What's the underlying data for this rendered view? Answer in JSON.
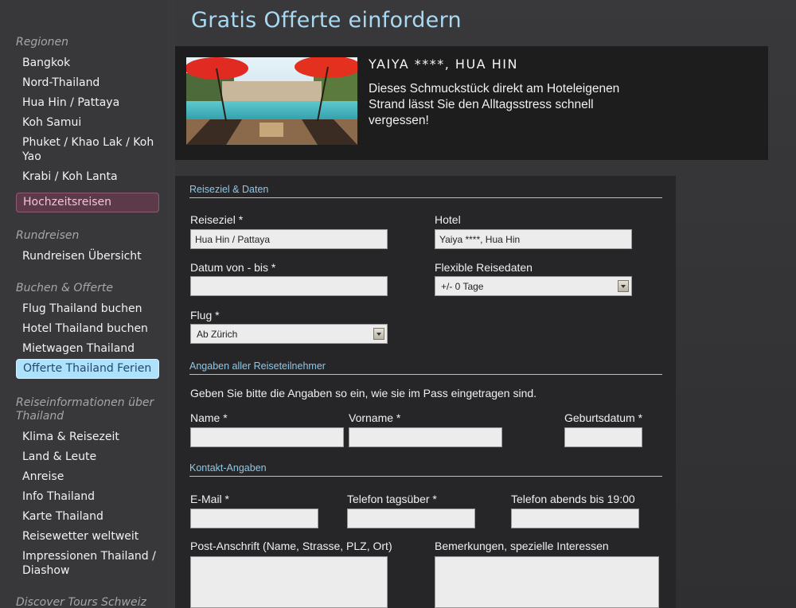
{
  "sidebar": {
    "regionen_title": "Regionen",
    "regionen": [
      "Bangkok",
      "Nord-Thailand",
      "Hua Hin / Pattaya",
      "Koh Samui",
      "Phuket / Khao Lak / Koh Yao",
      "Krabi / Koh Lanta"
    ],
    "hochzeit": "Hochzeitsreisen",
    "rundreisen_title": "Rundreisen",
    "rundreisen": [
      "Rundreisen Übersicht"
    ],
    "buchen_title": "Buchen & Offerte",
    "buchen": [
      "Flug Thailand buchen",
      "Hotel Thailand buchen",
      "Mietwagen Thailand"
    ],
    "buchen_active": "Offerte Thailand Ferien",
    "info_title": "Reiseinformationen über Thailand",
    "info": [
      "Klima & Reisezeit",
      "Land & Leute",
      "Anreise",
      "Info Thailand",
      "Karte Thailand",
      "Reisewetter weltweit",
      "Impressionen Thailand / Diashow"
    ],
    "discover_title": "Discover Tours Schweiz"
  },
  "page": {
    "title": "Gratis Offerte einfordern"
  },
  "hotel": {
    "name": "YAIYA ****, HUA HIN",
    "description": "Dieses Schmuckstück direkt am Hoteleigenen Strand lässt Sie den Alltagsstress schnell vergessen!"
  },
  "form": {
    "section1": "Reiseziel & Daten",
    "reiseziel_label": "Reiseziel *",
    "reiseziel_value": "Hua Hin / Pattaya",
    "hotel_label": "Hotel",
    "hotel_value": "Yaiya ****, Hua Hin",
    "datum_label": "Datum von - bis *",
    "datum_value": "",
    "flexible_label": "Flexible Reisedaten",
    "flexible_value": "+/- 0 Tage",
    "flug_label": "Flug *",
    "flug_value": "Ab Zürich",
    "section2": "Angaben aller Reiseteilnehmer",
    "passport_note": "Geben Sie bitte die Angaben so ein, wie sie im Pass eingetragen sind.",
    "name_label": "Name *",
    "vorname_label": "Vorname *",
    "geburtsdatum_label": "Geburtsdatum *",
    "section3": "Kontakt-Angaben",
    "email_label": "E-Mail *",
    "tel_tag_label": "Telefon tagsüber *",
    "tel_abend_label": "Telefon abends bis 19:00",
    "anschrift_label": "Post-Anschrift (Name, Strasse, PLZ, Ort)",
    "bemerkungen_label": "Bemerkungen, spezielle Interessen"
  }
}
